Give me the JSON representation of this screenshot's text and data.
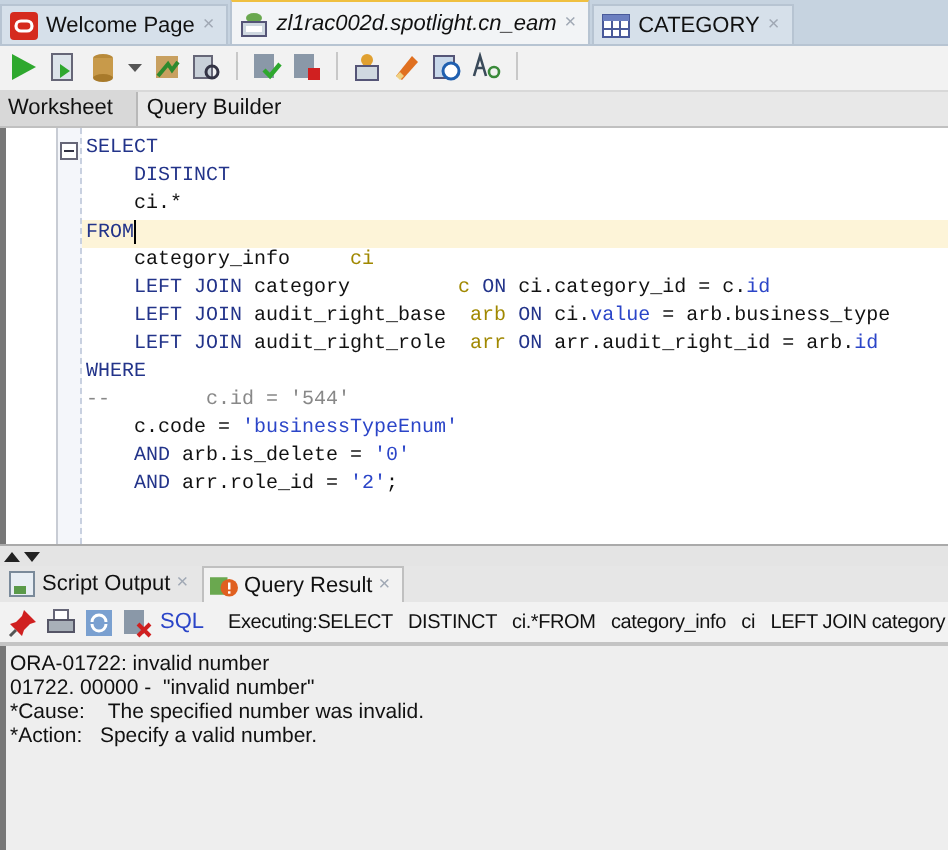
{
  "document_tabs": [
    {
      "label": "Welcome Page",
      "kind": "start",
      "selected": false,
      "close": "×"
    },
    {
      "label": "zl1rac002d.spotlight.cn_eam",
      "kind": "connection",
      "selected": true,
      "close": "×"
    },
    {
      "label": "CATEGORY",
      "kind": "table",
      "selected": false,
      "close": "×"
    }
  ],
  "editor_tabs": [
    {
      "label": "Worksheet",
      "selected": true
    },
    {
      "label": "Query Builder",
      "selected": false
    }
  ],
  "code_lines": [
    {
      "fold": true,
      "current": false,
      "tokens": [
        {
          "kind": "keyword",
          "text": "SELECT"
        }
      ]
    },
    {
      "current": false,
      "tokens": [
        {
          "kind": "keyword",
          "text": "    DISTINCT"
        }
      ]
    },
    {
      "current": false,
      "tokens": [
        {
          "kind": "plain",
          "text": "    ci.*"
        }
      ]
    },
    {
      "current": true,
      "tokens": [
        {
          "kind": "keyword",
          "text": "FROM"
        }
      ]
    },
    {
      "current": false,
      "tokens": [
        {
          "kind": "plain",
          "text": "    category_info     "
        },
        {
          "kind": "alias",
          "text": "ci"
        }
      ]
    },
    {
      "current": false,
      "tokens": [
        {
          "kind": "keyword",
          "text": "    LEFT JOIN "
        },
        {
          "kind": "plain",
          "text": "category         "
        },
        {
          "kind": "alias",
          "text": "c"
        },
        {
          "kind": "keyword",
          "text": " ON "
        },
        {
          "kind": "plain",
          "text": "ci.category_id = c."
        },
        {
          "kind": "ident",
          "text": "id"
        }
      ]
    },
    {
      "current": false,
      "tokens": [
        {
          "kind": "keyword",
          "text": "    LEFT JOIN "
        },
        {
          "kind": "plain",
          "text": "audit_right_base  "
        },
        {
          "kind": "alias",
          "text": "arb"
        },
        {
          "kind": "keyword",
          "text": " ON "
        },
        {
          "kind": "plain",
          "text": "ci."
        },
        {
          "kind": "ident",
          "text": "value"
        },
        {
          "kind": "plain",
          "text": " = arb.business_type"
        }
      ]
    },
    {
      "current": false,
      "tokens": [
        {
          "kind": "keyword",
          "text": "    LEFT JOIN "
        },
        {
          "kind": "plain",
          "text": "audit_right_role  "
        },
        {
          "kind": "alias",
          "text": "arr"
        },
        {
          "kind": "keyword",
          "text": " ON "
        },
        {
          "kind": "plain",
          "text": "arr.audit_right_id = arb."
        },
        {
          "kind": "ident",
          "text": "id"
        }
      ]
    },
    {
      "current": false,
      "tokens": [
        {
          "kind": "keyword",
          "text": "WHERE"
        }
      ]
    },
    {
      "current": false,
      "tokens": [
        {
          "kind": "comment",
          "text": "--        c.id = '544'"
        }
      ]
    },
    {
      "current": false,
      "tokens": [
        {
          "kind": "plain",
          "text": "    c.code = "
        },
        {
          "kind": "string",
          "text": "'businessTypeEnum'"
        }
      ]
    },
    {
      "current": false,
      "tokens": [
        {
          "kind": "keyword",
          "text": "    AND "
        },
        {
          "kind": "plain",
          "text": "arb.is_delete = "
        },
        {
          "kind": "string",
          "text": "'0'"
        }
      ]
    },
    {
      "current": false,
      "tokens": [
        {
          "kind": "keyword",
          "text": "    AND "
        },
        {
          "kind": "plain",
          "text": "arr.role_id = "
        },
        {
          "kind": "string",
          "text": "'2'"
        },
        {
          "kind": "plain",
          "text": ";"
        }
      ]
    }
  ],
  "output_tabs": [
    {
      "label": "Script Output",
      "kind": "script",
      "selected": false,
      "close": "×"
    },
    {
      "label": "Query Result",
      "kind": "error",
      "selected": true,
      "close": "×"
    }
  ],
  "result_toolbar": {
    "sql_link": "SQL",
    "status": "Executing:SELECT   DISTINCT   ci.*FROM   category_info   ci   LEFT JOIN category"
  },
  "messages": [
    "ORA-01722: invalid number",
    "01722. 00000 -  \"invalid number\"",
    "*Cause:    The specified number was invalid.",
    "*Action:   Specify a valid number."
  ]
}
